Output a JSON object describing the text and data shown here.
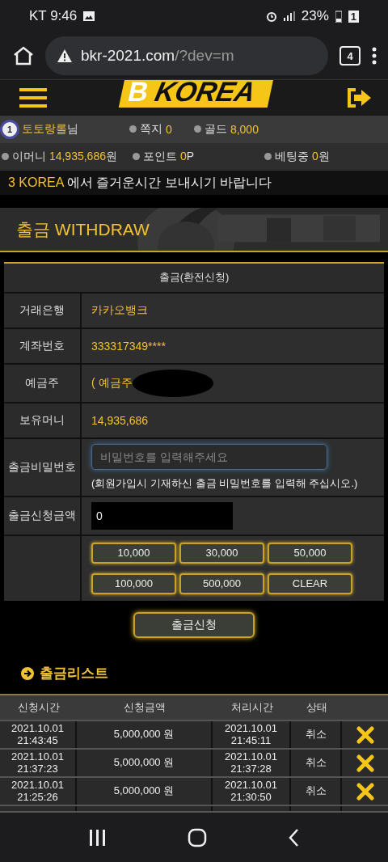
{
  "status_bar": {
    "carrier_time": "KT 9:46",
    "battery": "23%",
    "sim": "1"
  },
  "browser": {
    "url_host": "bkr-2021.com",
    "url_path": "/?dev=m",
    "tab_count": "4"
  },
  "header": {
    "logo_mark": "B",
    "logo_text": "KOREA"
  },
  "user_bar": {
    "level": "1",
    "nickname": "토토랑롤",
    "suffix": "님",
    "stats": [
      {
        "label": "쪽지",
        "value": "0"
      },
      {
        "label": "골드",
        "value": "8,000"
      }
    ]
  },
  "balance_bar": [
    {
      "label": "이머니",
      "value": "14,935,686",
      "unit": "원"
    },
    {
      "label": "포인트",
      "value": "0",
      "unit": "P"
    },
    {
      "label": "베팅중",
      "value": "0",
      "unit": "원"
    }
  ],
  "notice": {
    "brand": "3 KOREA",
    "text": "에서 즐거운시간 보내시기 바랍니다"
  },
  "banner": {
    "title_ko": "출금",
    "title_en": "WITHDRAW"
  },
  "form": {
    "title": "출금(환전신청)",
    "rows": [
      {
        "kind": "text",
        "label": "거래은행",
        "value": "카카오뱅크"
      },
      {
        "kind": "text",
        "label": "계좌번호",
        "value": "333317349****"
      },
      {
        "kind": "redacted",
        "label": "예금주",
        "value": "( 예금주"
      },
      {
        "kind": "text",
        "label": "보유머니",
        "value": "14,935,686"
      },
      {
        "kind": "password",
        "label": "출금비밀번호",
        "placeholder": "비밀번호를 입력해주세요",
        "hint": "(회원가입시 기재하신 출금 비밀번호를 입력해 주십시오.)"
      },
      {
        "kind": "amount",
        "label": "출금신청금액",
        "value": "0"
      }
    ],
    "amount_buttons": [
      "10,000",
      "30,000",
      "50,000",
      "100,000",
      "500,000",
      "CLEAR"
    ],
    "submit": "출금신청"
  },
  "list": {
    "title": "출금리스트",
    "columns": [
      "신청시간",
      "신청금액",
      "처리시간",
      "상태"
    ],
    "rows": [
      {
        "requested": [
          "2021.10.01",
          "21:43:45"
        ],
        "amount": "5,000,000 원",
        "processed": [
          "2021.10.01",
          "21:45:11"
        ],
        "status": "취소"
      },
      {
        "requested": [
          "2021.10.01",
          "21:37:23"
        ],
        "amount": "5,000,000 원",
        "processed": [
          "2021.10.01",
          "21:37:28"
        ],
        "status": "취소"
      },
      {
        "requested": [
          "2021.10.01",
          "21:25:26"
        ],
        "amount": "5,000,000 원",
        "processed": [
          "2021.10.01",
          "21:30:50"
        ],
        "status": "취소"
      }
    ]
  }
}
